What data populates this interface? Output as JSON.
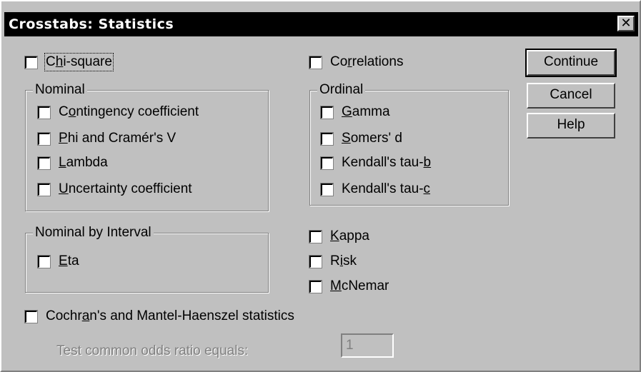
{
  "title": "Crosstabs: Statistics",
  "close_glyph": "✕",
  "buttons": {
    "continue": "Continue",
    "cancel": "Cancel",
    "help": "Help"
  },
  "checkboxes": {
    "chi_square": {
      "pre": "C",
      "u": "h",
      "post": "i-square",
      "checked": false
    },
    "correlations": {
      "pre": "Co",
      "u": "r",
      "post": "relations",
      "checked": false
    },
    "contingency": {
      "pre": "C",
      "u": "o",
      "post": "ntingency coefficient",
      "checked": false
    },
    "phi": {
      "pre": "",
      "u": "P",
      "post": "hi and Cramér's V",
      "checked": false
    },
    "lambda": {
      "pre": "",
      "u": "L",
      "post": "ambda",
      "checked": false
    },
    "uncertainty": {
      "pre": "",
      "u": "U",
      "post": "ncertainty coefficient",
      "checked": false
    },
    "gamma": {
      "pre": "",
      "u": "G",
      "post": "amma",
      "checked": false
    },
    "somers": {
      "pre": "",
      "u": "S",
      "post": "omers' d",
      "checked": false
    },
    "tau_b": {
      "pre": "Kendall's tau-",
      "u": "b",
      "post": "",
      "checked": false
    },
    "tau_c": {
      "pre": "Kendall's tau-",
      "u": "c",
      "post": "",
      "checked": false
    },
    "eta": {
      "pre": "",
      "u": "E",
      "post": "ta",
      "checked": false
    },
    "kappa": {
      "pre": "",
      "u": "K",
      "post": "appa",
      "checked": false
    },
    "risk": {
      "pre": "R",
      "u": "i",
      "post": "sk",
      "checked": false
    },
    "mcnemar": {
      "pre": "",
      "u": "M",
      "post": "cNemar",
      "checked": false
    },
    "cochran": {
      "pre": "Cochr",
      "u": "a",
      "post": "n's and Mantel-Haenszel statistics",
      "checked": false
    }
  },
  "groups": {
    "nominal": "Nominal",
    "ordinal": "Ordinal",
    "nominal_by_interval": "Nominal by Interval"
  },
  "odds": {
    "label": "Test common odds ratio equals:",
    "value": "1"
  }
}
